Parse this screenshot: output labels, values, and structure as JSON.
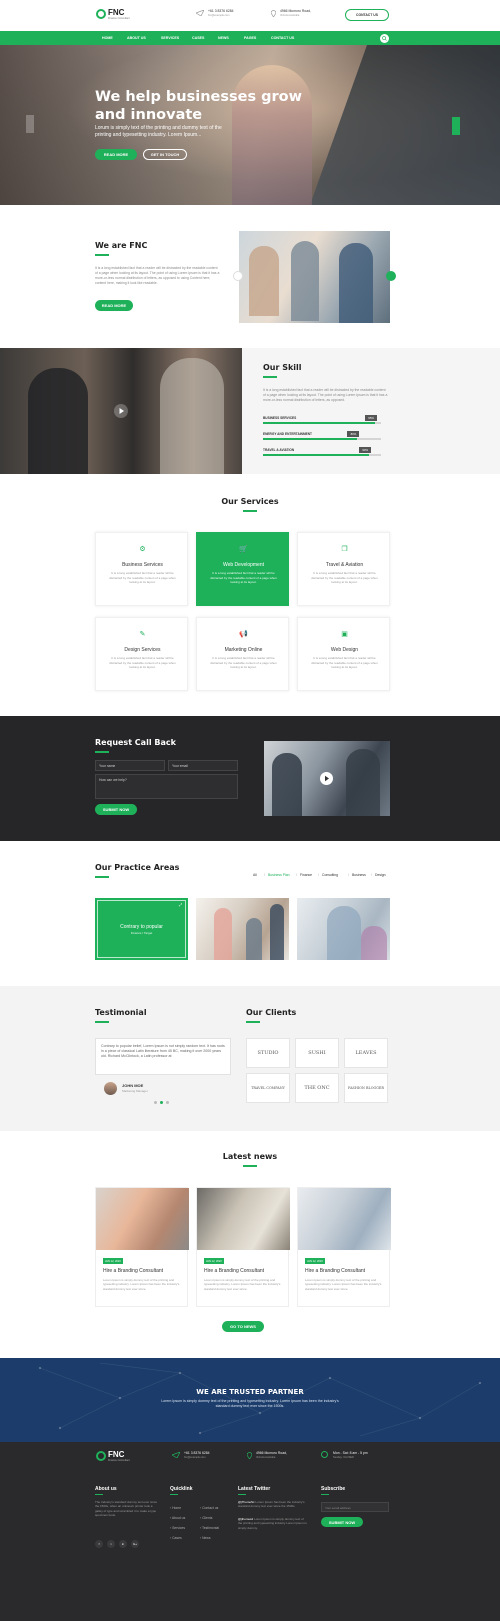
{
  "topbar": {
    "logo_text": "FNC",
    "logo_sub": "Finance Consultant",
    "phone": "+61 3 8376 6284",
    "email": "fnc@example.com",
    "address": "4966 Mumoro Road,",
    "address_sub": "Victoria Australia",
    "contact_button": "CONTACT US"
  },
  "nav": {
    "items": [
      "HOME",
      "ABOUT US",
      "SERVICES",
      "CASES",
      "NEWS",
      "PAGES",
      "CONTACT US"
    ]
  },
  "hero": {
    "title_line1": "We help businesses grow",
    "title_line2": "and innovate",
    "text_line1": "Lorum is simply text of the printing and dummy text of the",
    "text_line2": "printing and typesetting industry. Lorem Ipsum...",
    "btn_read": "READ MORE",
    "btn_touch": "GET IN TOUCH"
  },
  "about": {
    "title": "We are FNC",
    "text": "It is a long established fact that a reader will be distracted by the readable content of a page when looking at its layout. The point of using Lorem Ipsum is that it has a more-or-less normal distribution of letters, as opposed to using Content here, content here, making it look like readable.",
    "button": "READ MORE"
  },
  "skill": {
    "title": "Our Skill",
    "text": "It is a long established fact that a reader will be distracted by the readable content of a page when looking at its layout. The point of using Lorem Ipsum is that it has a more-or-less normal distribution of letters, as opposed.",
    "items": [
      {
        "label": "BUSINESS SERVICES",
        "pct": "95%",
        "value": 95
      },
      {
        "label": "ENERGY AND ENTERTAINMENT",
        "pct": "80%",
        "value": 80
      },
      {
        "label": "TRAVEL & AVIATION",
        "pct": "90%",
        "value": 90
      }
    ]
  },
  "services": {
    "title": "Our Services",
    "items": [
      {
        "name": "Business Services",
        "icon": "gear-icon",
        "text": "It is a long established fact that a reader will be distracted by the readable content of a page when looking at its layout."
      },
      {
        "name": "Web Development",
        "icon": "cart-icon",
        "text": "It is a long established fact that a reader will be distracted by the readable content of a page when looking at its layout."
      },
      {
        "name": "Travel & Aviation",
        "icon": "docs-icon",
        "text": "It is a long established fact that a reader will be distracted by the readable content of a page when looking at its layout."
      },
      {
        "name": "Design Services",
        "icon": "palette-icon",
        "text": "It is a long established fact that a reader will be distracted by the readable content of a page when looking at its layout."
      },
      {
        "name": "Marketing Online",
        "icon": "megaphone-icon",
        "text": "It is a long established fact that a reader will be distracted by the readable content of a page when looking at its layout."
      },
      {
        "name": "Web Design",
        "icon": "monitor-icon",
        "text": "It is a long established fact that a reader will be distracted by the readable content of a page when looking at its layout."
      }
    ]
  },
  "callback": {
    "title": "Request Call Back",
    "name_placeholder": "Your name",
    "email_placeholder": "Your email",
    "message_placeholder": "How can we help?",
    "submit": "SUBMIT NOW"
  },
  "practice": {
    "title": "Our Practice Areas",
    "filters": [
      "All",
      "Business Plan",
      "Finance",
      "Consulting",
      "Business",
      "Design"
    ],
    "active_card_title": "Contrary to popular",
    "active_card_sub": "Finance / Target"
  },
  "testimonial": {
    "title": "Testimonial",
    "quote": "Contrary to popular belief, Lorem Ipsum is not simply random text. It has roots in a piece of classical Latin literature from 45 BC, making it over 2000 years old. Richard McClintock, a Latin professor at",
    "author": "JOHN MOE",
    "role": "Marketing Manager"
  },
  "clients": {
    "title": "Our Clients",
    "logos": [
      "STUDIO",
      "SUSHI",
      "LEAVES",
      "TRAVEL COMPANY",
      "THE ONC",
      "FASHION BLOGGER"
    ]
  },
  "news": {
    "title": "Latest news",
    "items": [
      {
        "date": "JAN 12, 2023",
        "title": "Hire a Branding Consultant",
        "text": "Lorem Ipsum is simply dummy text of the printing and typesetting industry. Lorem Ipsum has been the industry's standard dummy text ever since."
      },
      {
        "date": "JAN 12, 2023",
        "title": "Hire a Branding Consultant",
        "text": "Lorem Ipsum is simply dummy text of the printing and typesetting industry. Lorem Ipsum has been the industry's standard dummy text ever since."
      },
      {
        "date": "JAN 12, 2023",
        "title": "Hire a Branding Consultant",
        "text": "Lorem Ipsum is simply dummy text of the printing and typesetting industry. Lorem Ipsum has been the industry's standard dummy text ever since."
      }
    ],
    "button": "GO TO NEWS"
  },
  "partner": {
    "title": "WE ARE TRUSTED PARTNER",
    "text_line1": "Lorem Ipsum is simply dummy text of the printing and typesetting industry. Lorem Ipsum has been the industry's",
    "text_line2": "standard dummy text ever since the 1500s."
  },
  "footer": {
    "logo_text": "FNC",
    "logo_sub": "Finance Consultant",
    "phone": "+61 3 8376 6284",
    "email": "fnc@example.com",
    "address": "4966 Mumoro Road,",
    "address_sub": "Victoria Australia",
    "hours": "Mon - Sat: 8 am - 5 pm",
    "hours_sub": "Sunday: CLOSED",
    "about_title": "About us",
    "about_text": "The Industry's standard dummy text ever since the 1500s, when an unknown printer took a galley of type and scrambled it to make a type specimen book.",
    "quick_title": "Quicklink",
    "quick_col1": [
      "Home",
      "About us",
      "Services",
      "Cases"
    ],
    "quick_col2": [
      "Contact us",
      "Clients",
      "Testimonial",
      "News"
    ],
    "twitter_title": "Latest Twitter",
    "tweet1_user": "@jThemeSc",
    "tweet1_text": "Lorem Ipsum has been the industry's standard dummy text ever since the 1500s.",
    "tweet2_user": "@jthemes2",
    "tweet2_text": "Lorem Ipsum is simply dummy text of the printing and typesetting industry Lorem Ipsum is simply dummy.",
    "subscribe_title": "Subscribe",
    "subscribe_placeholder": "Your email address",
    "subscribe_button": "SUBMIT NOW",
    "social": [
      "f",
      "t",
      "in",
      "G+"
    ]
  },
  "colors": {
    "accent": "#1fb15a",
    "dark": "#2a2a2c",
    "navy": "#1c3d6b"
  }
}
